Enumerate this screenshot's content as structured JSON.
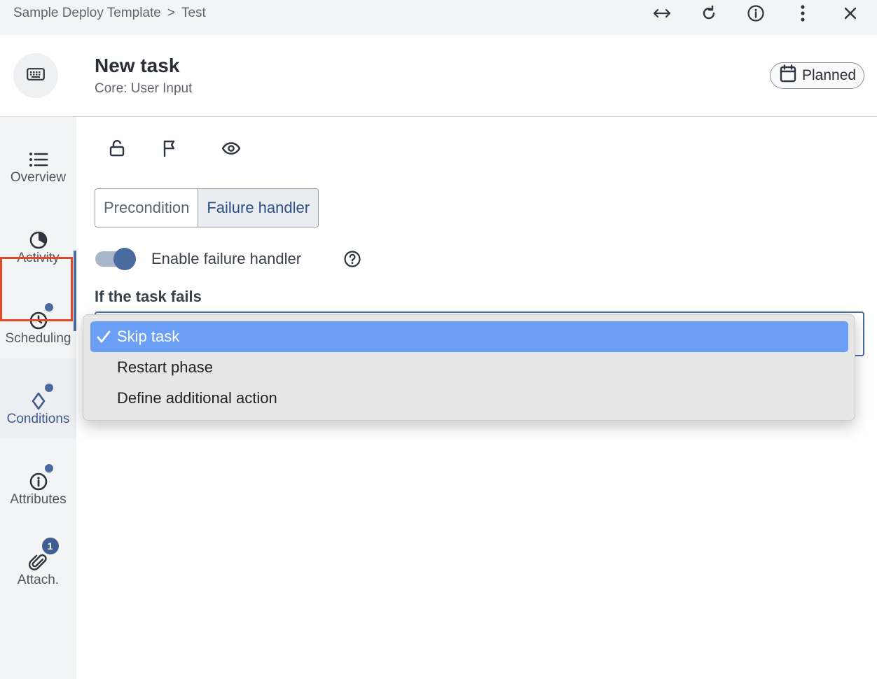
{
  "breadcrumb": {
    "parent": "Sample Deploy Template",
    "separator": ">",
    "current": "Test"
  },
  "topbar_icons": [
    "expand-horizontal-icon",
    "refresh-icon",
    "info-icon",
    "more-vertical-icon",
    "close-icon"
  ],
  "header": {
    "title": "New task",
    "subtitle": "Core: User Input",
    "status": "Planned",
    "avatar_icon": "keyboard-icon",
    "status_icon": "calendar-icon"
  },
  "sidebar": {
    "items": [
      {
        "label": "Overview",
        "icon": "list-icon"
      },
      {
        "label": "Activity",
        "icon": "pie-clock-icon"
      },
      {
        "label": "Scheduling",
        "icon": "clock-icon",
        "dot": true
      },
      {
        "label": "Conditions",
        "icon": "diamond-icon",
        "dot": true,
        "active": true
      },
      {
        "label": "Attributes",
        "icon": "info-icon",
        "dot": true
      },
      {
        "label": "Attach.",
        "icon": "paperclip-icon",
        "badge": "1"
      }
    ]
  },
  "toolbar_icons": [
    "unlock-icon",
    "flag-icon",
    "eye-icon"
  ],
  "tabs": {
    "precondition": "Precondition",
    "failure_handler": "Failure handler",
    "selected": "Failure handler"
  },
  "toggle": {
    "label": "Enable failure handler",
    "enabled": true
  },
  "field": {
    "label": "If the task fails"
  },
  "dropdown": {
    "options": [
      "Skip task",
      "Restart phase",
      "Define additional action"
    ],
    "selected": "Skip task"
  },
  "colors": {
    "accent": "#4a6ba0",
    "highlight": "#e04a2b",
    "selected_option": "#6a9ff5"
  }
}
